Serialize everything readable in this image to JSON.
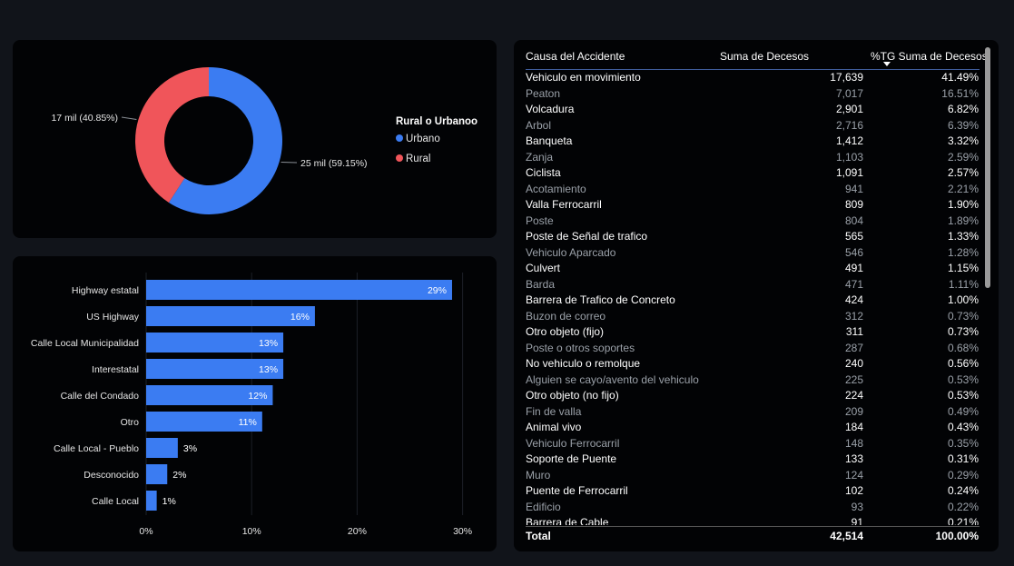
{
  "colors": {
    "urbano": "#3b7cf2",
    "rural": "#f0555a",
    "bar": "#3b7cf2",
    "background": "#11141a",
    "card": "#020305"
  },
  "donut": {
    "legend_title": "Rural o Urbanoo",
    "labels": [
      "25 mil (59.15%)",
      "17 mil (40.85%)"
    ]
  },
  "table": {
    "headers": [
      "Causa del Accidente",
      "Suma de Decesos",
      "%TG Suma de Decesos"
    ],
    "rows": [
      [
        "Vehiculo en movimiento",
        "17,639",
        "41.49%"
      ],
      [
        "Peaton",
        "7,017",
        "16.51%"
      ],
      [
        "Volcadura",
        "2,901",
        "6.82%"
      ],
      [
        "Arbol",
        "2,716",
        "6.39%"
      ],
      [
        "Banqueta",
        "1,412",
        "3.32%"
      ],
      [
        "Zanja",
        "1,103",
        "2.59%"
      ],
      [
        "Ciclista",
        "1,091",
        "2.57%"
      ],
      [
        "Acotamiento",
        "941",
        "2.21%"
      ],
      [
        "Valla Ferrocarril",
        "809",
        "1.90%"
      ],
      [
        "Poste",
        "804",
        "1.89%"
      ],
      [
        "Poste de Señal de trafico",
        "565",
        "1.33%"
      ],
      [
        "Vehiculo Aparcado",
        "546",
        "1.28%"
      ],
      [
        "Culvert",
        "491",
        "1.15%"
      ],
      [
        "Barda",
        "471",
        "1.11%"
      ],
      [
        "Barrera de Trafico de Concreto",
        "424",
        "1.00%"
      ],
      [
        "Buzon de correo",
        "312",
        "0.73%"
      ],
      [
        "Otro objeto (fijo)",
        "311",
        "0.73%"
      ],
      [
        "Poste o otros soportes",
        "287",
        "0.68%"
      ],
      [
        "No vehiculo o remolque",
        "240",
        "0.56%"
      ],
      [
        "Alguien se cayo/avento del vehiculo",
        "225",
        "0.53%"
      ],
      [
        "Otro objeto (no fijo)",
        "224",
        "0.53%"
      ],
      [
        "Fin de valla",
        "209",
        "0.49%"
      ],
      [
        "Animal vivo",
        "184",
        "0.43%"
      ],
      [
        "Vehiculo Ferrocarril",
        "148",
        "0.35%"
      ],
      [
        "Soporte de Puente",
        "133",
        "0.31%"
      ],
      [
        "Muro",
        "124",
        "0.29%"
      ],
      [
        "Puente de Ferrocarril",
        "102",
        "0.24%"
      ],
      [
        "Edificio",
        "93",
        "0.22%"
      ],
      [
        "Barrera de Cable",
        "91",
        "0.21%"
      ]
    ],
    "total": [
      "Total",
      "42,514",
      "100.00%"
    ]
  },
  "chart_data": [
    {
      "type": "pie",
      "donut": true,
      "legend_title": "Rural o Urbanoo",
      "legend_placement": "right",
      "categories": [
        "Urbano",
        "Rural"
      ],
      "values": [
        25148,
        17366
      ],
      "percent": [
        59.15,
        40.85
      ],
      "data_labels": [
        "25 mil (59.15%)",
        "17 mil (40.85%)"
      ]
    },
    {
      "type": "bar",
      "orientation": "horizontal",
      "categories": [
        "Highway estatal",
        "US Highway",
        "Calle Local Municipalidad",
        "Interestatal",
        "Calle del Condado",
        "Otro",
        "Calle Local - Pueblo",
        "Desconocido",
        "Calle Local"
      ],
      "values": [
        29,
        16,
        13,
        13,
        12,
        11,
        3,
        2,
        1
      ],
      "value_labels": [
        "29%",
        "16%",
        "13%",
        "13%",
        "12%",
        "11%",
        "3%",
        "2%",
        "1%"
      ],
      "xticks": [
        "0%",
        "10%",
        "20%",
        "30%"
      ],
      "xlim": [
        0,
        30
      ],
      "grid": true
    }
  ]
}
